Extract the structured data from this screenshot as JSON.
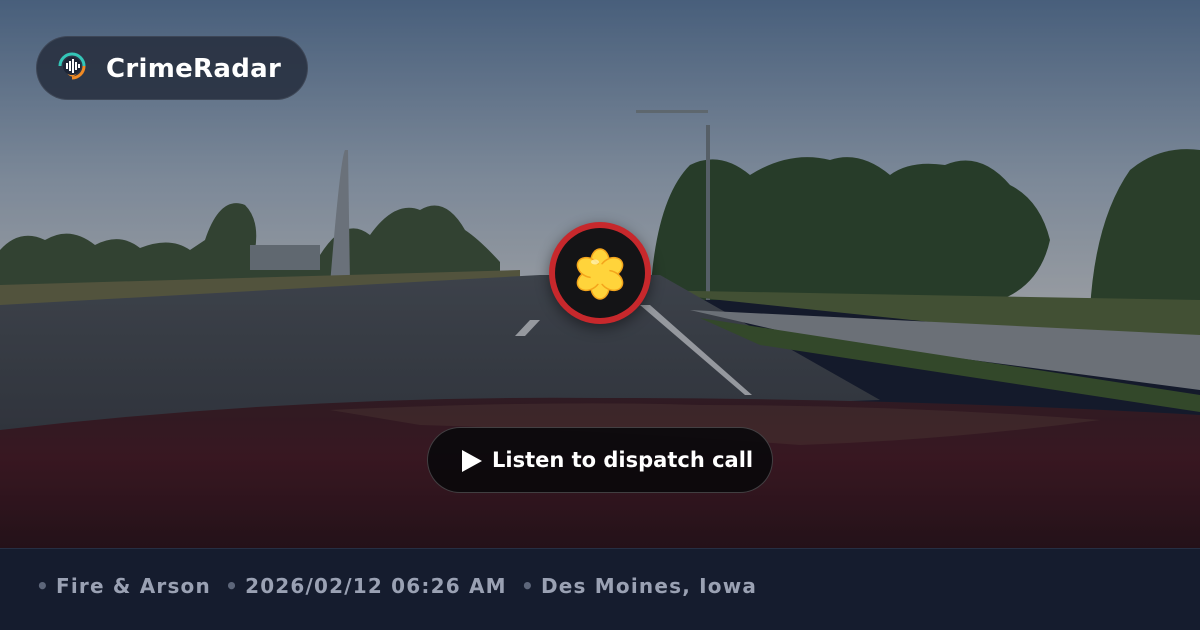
{
  "brand": {
    "name": "CrimeRadar",
    "logo_icon": "location-pin-soundwave-icon",
    "logo_colors": {
      "ring_teal": "#34c6b8",
      "ring_orange": "#f08a24",
      "pin": "#f08a24"
    }
  },
  "incident": {
    "category_icon": "fire-asterisk-icon",
    "badge_ring_color": "#c7282c",
    "icon_color": "#ffd43b"
  },
  "player": {
    "button_label": "Listen to dispatch call",
    "play_icon": "play-icon"
  },
  "footer": {
    "separator": "•",
    "category": "Fire & Arson",
    "datetime": "2026/02/12 06:26 AM",
    "location": "Des Moines, Iowa"
  },
  "background": {
    "description_icon": "street-photo",
    "sky_color": "#6f8aa6",
    "hood_color": "#4a1a22"
  }
}
